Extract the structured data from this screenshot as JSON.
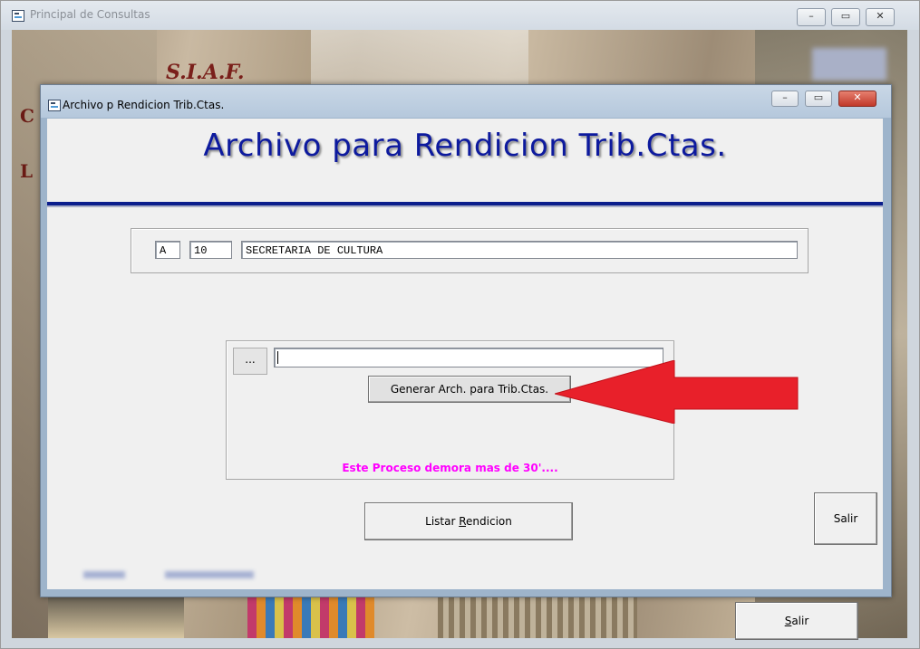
{
  "outer_window": {
    "title": "Principal de Consultas",
    "bg_title": "S.I.A.F.",
    "bg_side_letters": [
      "C",
      "L"
    ],
    "salir_label_prefix": "",
    "salir_label_underlined": "S",
    "salir_label_rest": "alir"
  },
  "dialog": {
    "title": "Archivo p Rendicion Trib.Ctas.",
    "heading": "Archivo para Rendicion Trib.Ctas.",
    "org": {
      "letter": "A",
      "number": "10",
      "name": "SECRETARIA DE CULTURA"
    },
    "browse_label": "...",
    "path_value": "",
    "generate_label": "Generar Arch. para Trib.Ctas.",
    "warning": "Este Proceso demora mas de 30'....",
    "salir_label": "Salir",
    "listar_prefix": "Listar ",
    "listar_underlined": "R",
    "listar_rest": "endicion"
  },
  "window_controls": [
    "minimize",
    "maximize",
    "close"
  ],
  "colors": {
    "heading": "#0d1a9e",
    "divider": "#0b1e8c",
    "warning": "#ff00ff",
    "arrow": "#e8202a"
  },
  "icons": [
    "app-icon",
    "arrow-annotation"
  ]
}
